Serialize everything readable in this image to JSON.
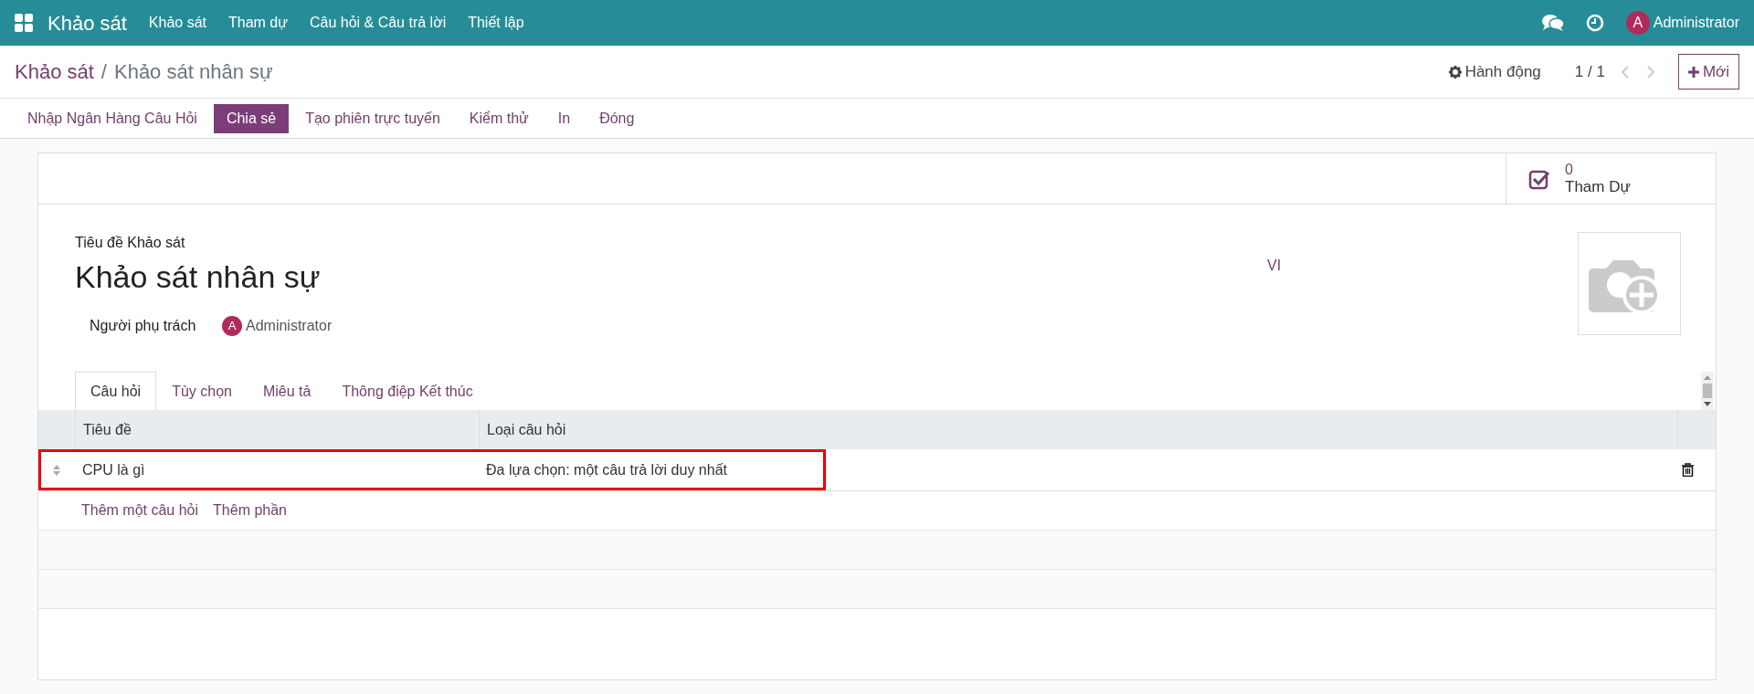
{
  "navbar": {
    "app_name": "Khảo sát",
    "menu": [
      "Khảo sát",
      "Tham dự",
      "Câu hỏi & Câu trả lời",
      "Thiết lập"
    ],
    "user": {
      "initial": "A",
      "name": "Administrator"
    }
  },
  "breadcrumb": {
    "parent": "Khảo sát",
    "separator": "/",
    "current": "Khảo sát nhân sự"
  },
  "control_panel": {
    "action": "Hành động",
    "pager": "1 / 1",
    "new_button": "Mới"
  },
  "buttons": [
    {
      "label": "Nhập Ngân Hàng Câu Hỏi",
      "selected": false
    },
    {
      "label": "Chia sẻ",
      "selected": true
    },
    {
      "label": "Tạo phiên trực tuyến",
      "selected": false
    },
    {
      "label": "Kiểm thử",
      "selected": false
    },
    {
      "label": "In",
      "selected": false
    },
    {
      "label": "Đóng",
      "selected": false
    }
  ],
  "stat_button": {
    "value": "0",
    "label": "Tham Dự"
  },
  "form": {
    "title_label": "Tiêu đề Khảo sát",
    "title": "Khảo sát nhân sự",
    "language": "VI",
    "responsible_label": "Người phụ trách",
    "responsible": {
      "initial": "A",
      "name": "Administrator"
    }
  },
  "tabs": [
    {
      "label": "Câu hỏi",
      "selected": true
    },
    {
      "label": "Tùy chọn",
      "selected": false
    },
    {
      "label": "Miêu tả",
      "selected": false
    },
    {
      "label": "Thông điệp Kết thúc",
      "selected": false
    }
  ],
  "table": {
    "columns": [
      "Tiêu đề",
      "Loại câu hỏi"
    ],
    "rows": [
      {
        "title": "CPU là gì",
        "type": "Đa lựa chọn: một câu trả lời duy nhất",
        "highlighted": true
      }
    ],
    "add_links": [
      "Thêm một câu hỏi",
      "Thêm phần"
    ]
  }
}
